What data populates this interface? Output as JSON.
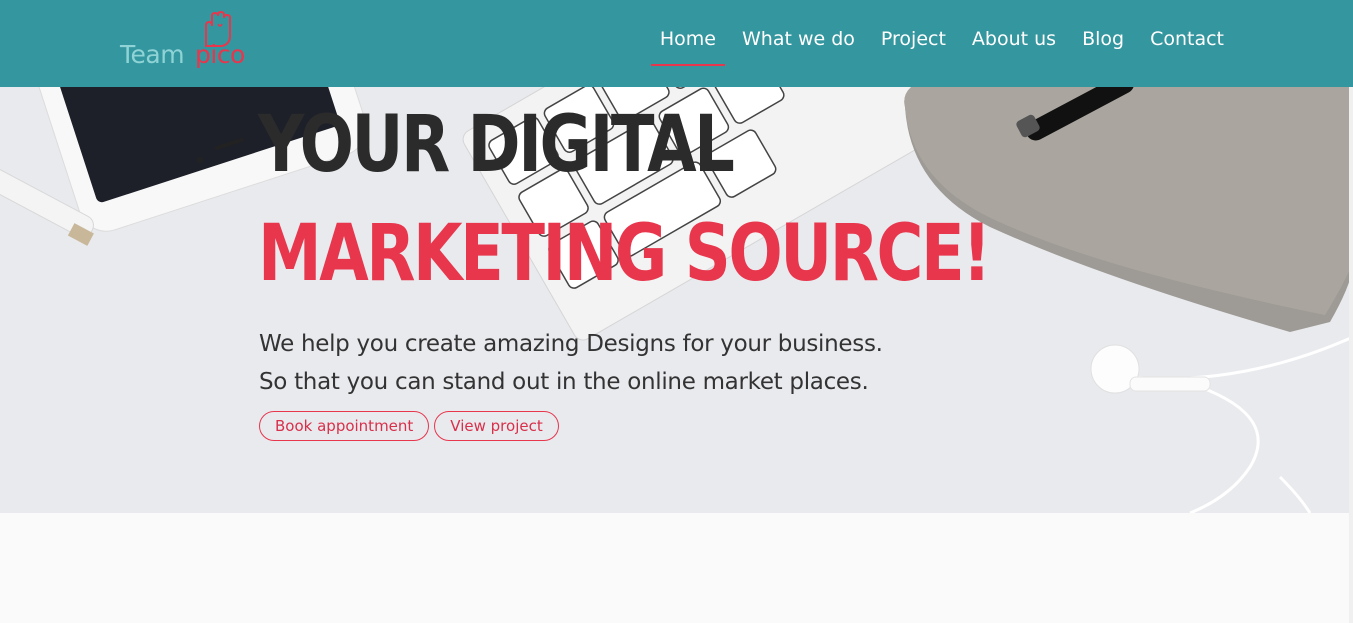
{
  "logo": {
    "brand_a": "Team",
    "brand_b": "pico",
    "colors": {
      "team": "#8fd3d6",
      "pico": "#e8364d"
    }
  },
  "nav": {
    "items": [
      {
        "label": "Home",
        "active": true
      },
      {
        "label": "What we do",
        "active": false
      },
      {
        "label": "Project",
        "active": false
      },
      {
        "label": "About us",
        "active": false
      },
      {
        "label": "Blog",
        "active": false
      },
      {
        "label": "Contact",
        "active": false
      }
    ]
  },
  "hero": {
    "headline_line1": "YOUR DIGITAL",
    "headline_line2": "MARKETING SOURCE!",
    "subtext_line1": "We help you create amazing Designs for your business.",
    "subtext_line2": "So that you can stand out in the online market places.",
    "primary_button": "Book appointment",
    "secondary_button": "View project"
  },
  "colors": {
    "navbar": "#34969e",
    "accent": "#e8364d",
    "heading": "#2b2b2b"
  }
}
